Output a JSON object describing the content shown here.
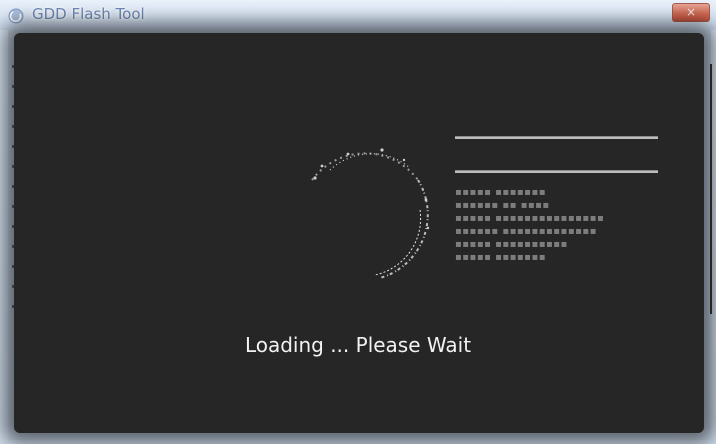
{
  "window": {
    "title": "GDD Flash Tool",
    "close_glyph": "×",
    "app_icon": "app-icon"
  },
  "splash": {
    "loading_text": "Loading ... Please Wait",
    "spinner_icon": "loading-spinner-icon"
  },
  "colors": {
    "stage_background": "#262626",
    "titlebar": "#d6e3f2",
    "title_text": "#6c88b5",
    "close_button": "#cf6b55"
  }
}
